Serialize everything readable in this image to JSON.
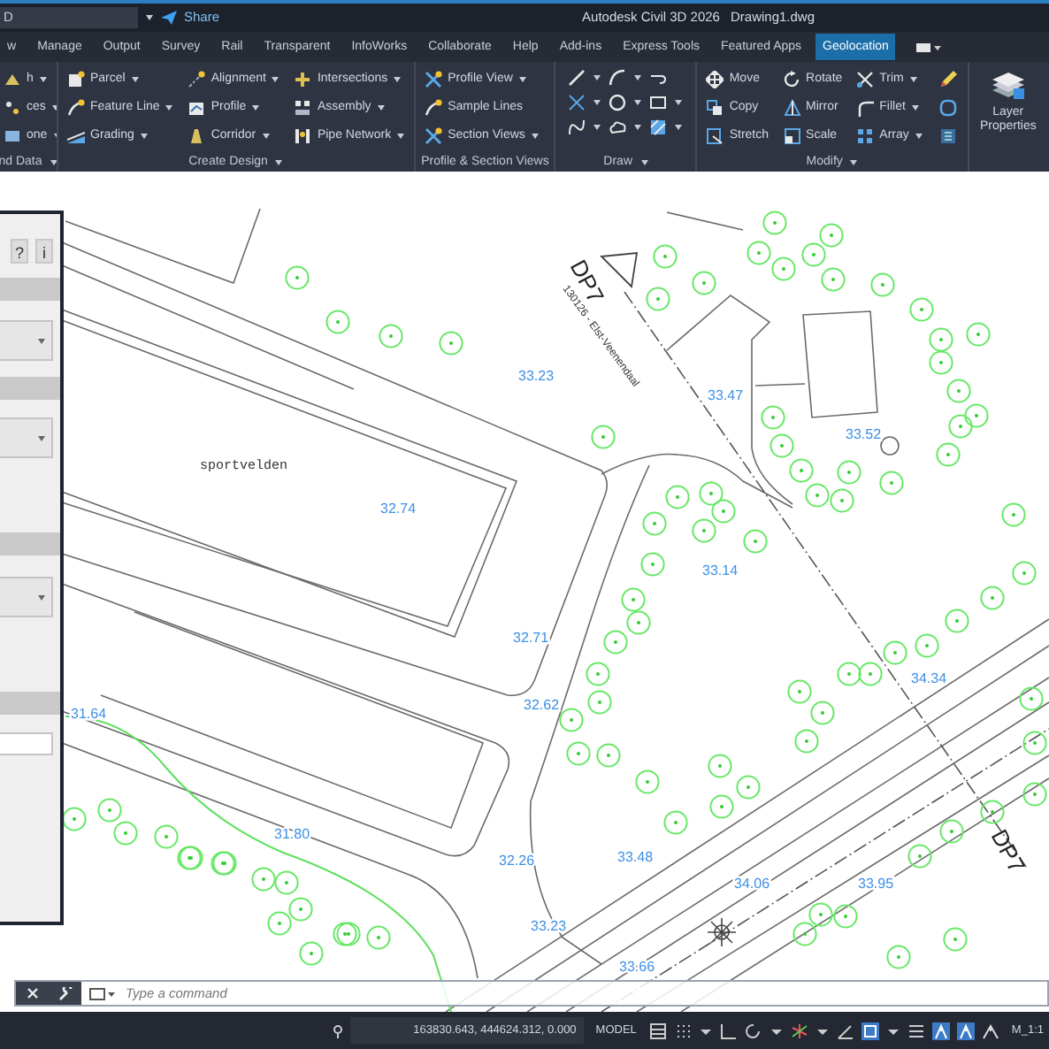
{
  "title_bar": {
    "workspace": "D",
    "share": "Share",
    "title": "Autodesk Civil 3D 2026",
    "file": "Drawing1.dwg"
  },
  "ribbon_tabs": [
    {
      "label": "w",
      "selected": false
    },
    {
      "label": "Manage",
      "selected": false
    },
    {
      "label": "Output",
      "selected": false
    },
    {
      "label": "Survey",
      "selected": false
    },
    {
      "label": "Rail",
      "selected": false
    },
    {
      "label": "Transparent",
      "selected": false
    },
    {
      "label": "InfoWorks",
      "selected": false
    },
    {
      "label": "Collaborate",
      "selected": false
    },
    {
      "label": "Help",
      "selected": false
    },
    {
      "label": "Add-ins",
      "selected": false
    },
    {
      "label": "Express Tools",
      "selected": false
    },
    {
      "label": "Featured Apps",
      "selected": false
    },
    {
      "label": "Geolocation",
      "selected": true
    }
  ],
  "ribbon_panels": [
    {
      "label": "nd Data",
      "dropdown": true,
      "kind": "tools",
      "columns": [
        [
          {
            "label": "h",
            "kind": "surface",
            "dropdown": true
          },
          {
            "label": "ces",
            "kind": "points",
            "dropdown": true
          },
          {
            "label": "one",
            "kind": "zone",
            "dropdown": true
          }
        ]
      ]
    },
    {
      "label": "Create Design",
      "dropdown": true,
      "kind": "tools",
      "columns": [
        [
          {
            "label": "Parcel",
            "kind": "parcel",
            "dropdown": true
          },
          {
            "label": "Feature Line",
            "kind": "featureline",
            "dropdown": true
          },
          {
            "label": "Grading",
            "kind": "grading",
            "dropdown": true
          }
        ],
        [
          {
            "label": "Alignment",
            "kind": "alignment",
            "dropdown": true
          },
          {
            "label": "Profile",
            "kind": "profile",
            "dropdown": true
          },
          {
            "label": "Corridor",
            "kind": "corridor",
            "dropdown": true
          }
        ],
        [
          {
            "label": "Intersections",
            "kind": "intersection",
            "dropdown": true
          },
          {
            "label": "Assembly",
            "kind": "assembly",
            "dropdown": true
          },
          {
            "label": "Pipe Network",
            "kind": "pipe",
            "dropdown": true
          }
        ]
      ]
    },
    {
      "label": "Profile & Section Views",
      "kind": "tools",
      "columns": [
        [
          {
            "label": "Profile View",
            "kind": "profileview",
            "dropdown": true
          },
          {
            "label": "Sample Lines",
            "kind": "featureline",
            "dropdown": false
          },
          {
            "label": "Section Views",
            "kind": "profileview",
            "dropdown": true
          }
        ]
      ]
    },
    {
      "label": "Draw",
      "dropdown": true,
      "kind": "draw"
    },
    {
      "label": "Modify",
      "dropdown": true,
      "kind": "tools",
      "columns": [
        [
          {
            "label": "Move",
            "kind": "move",
            "dropdown": false
          },
          {
            "label": "Copy",
            "kind": "copy",
            "dropdown": false
          },
          {
            "label": "Stretch",
            "kind": "stretch",
            "dropdown": false
          }
        ],
        [
          {
            "label": "Rotate",
            "kind": "rotate",
            "dropdown": false
          },
          {
            "label": "Mirror",
            "kind": "mirror",
            "dropdown": false
          },
          {
            "label": "Scale",
            "kind": "scale",
            "dropdown": false
          }
        ],
        [
          {
            "label": "Trim",
            "kind": "trim",
            "dropdown": true
          },
          {
            "label": "Fillet",
            "kind": "fillet",
            "dropdown": true
          },
          {
            "label": "Array",
            "kind": "array",
            "dropdown": true
          }
        ]
      ]
    }
  ],
  "layer_button": {
    "label": "Layer Properties"
  },
  "palette": {
    "help": "?",
    "info": "i"
  },
  "drawing": {
    "area_labels": [
      "sportvelden"
    ],
    "station_markers": [
      "DP7",
      "DP7"
    ],
    "line_label": "130126 - Elst-Veenendaal",
    "elevation_labels": [
      "33.23",
      "32.74",
      "33.47",
      "33.52",
      "33.14",
      "32.71",
      "34.34",
      "32.62",
      "31.64",
      "31.80",
      "32.26",
      "33.48",
      "34.06",
      "33.95",
      "33.23",
      "33.66"
    ]
  },
  "command_line": {
    "placeholder": "Type a command"
  },
  "status_bar": {
    "coordinates": "163830.643, 444624.312, 0.000",
    "space": "MODEL",
    "scale": "M_1:1"
  }
}
